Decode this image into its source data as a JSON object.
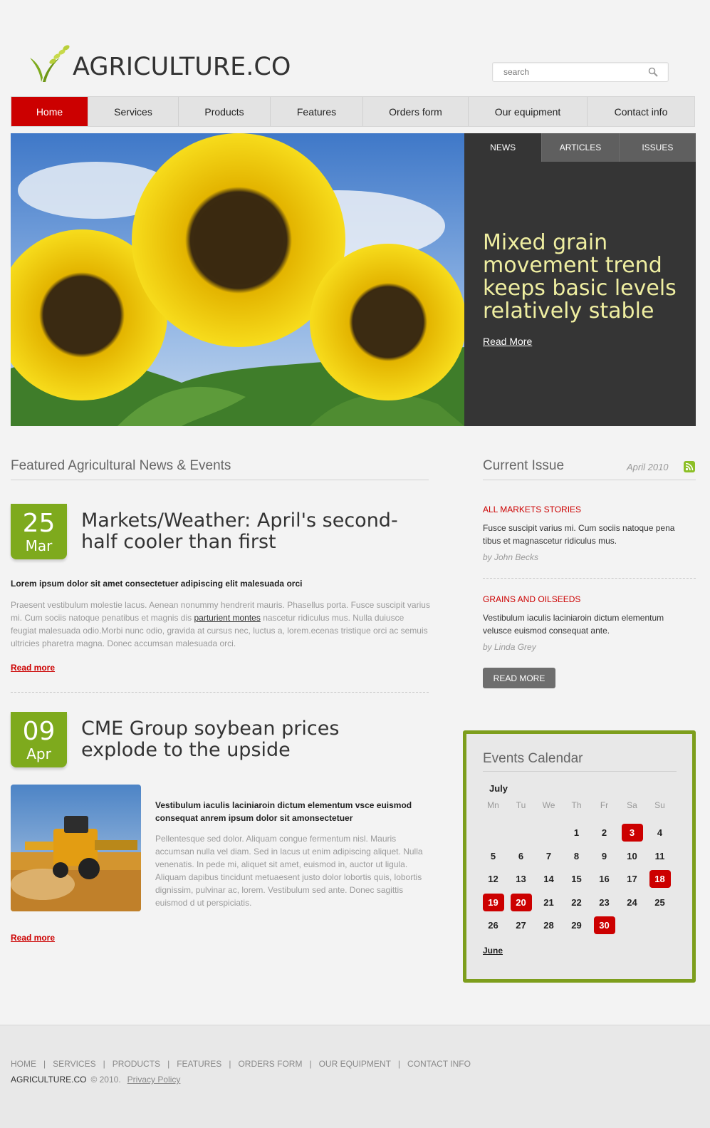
{
  "brand": {
    "name": "AGRICULTURE.CO",
    "accent": "#cc0000",
    "green": "#7eaa1d"
  },
  "search": {
    "placeholder": "search"
  },
  "nav": [
    {
      "label": "Home",
      "active": true
    },
    {
      "label": "Services"
    },
    {
      "label": "Products"
    },
    {
      "label": "Features"
    },
    {
      "label": "Orders form"
    },
    {
      "label": "Our equipment"
    },
    {
      "label": "Contact info"
    }
  ],
  "hero": {
    "tabs": [
      "NEWS",
      "ARTICLES",
      "ISSUES"
    ],
    "headline": "Mixed grain movement trend keeps basic levels relatively stable",
    "read_more": "Read More"
  },
  "featured": {
    "title": "Featured Agricultural News & Events",
    "articles": [
      {
        "day": "25",
        "month": "Mar",
        "title": "Markets/Weather: April's second-half cooler than first",
        "lead": "Lorem ipsum dolor sit amet consectetuer adipiscing elit malesuada orci",
        "body_before": "Praesent vestibulum molestie lacus. Aenean nonummy hendrerit mauris. Phasellus porta. Fusce suscipit varius mi. Cum sociis natoque penatibus et magnis dis ",
        "body_link": "parturient montes",
        "body_after": " nascetur ridiculus mus. Nulla duiusce feugiat malesuada odio.Morbi nunc odio, gravida at cursus nec, luctus a, lorem.ecenas tristique orci ac semuis ultricies pharetra magna. Donec accumsan malesuada orci.",
        "read_more": "Read more"
      },
      {
        "day": "09",
        "month": "Apr",
        "title": "CME Group soybean prices explode to the upside",
        "lead": "Vestibulum iaculis laciniaroin dictum elementum vsce euismod consequat anrem ipsum dolor sit amonsectetuer",
        "body": "Pellentesque sed dolor. Aliquam congue fermentum nisl. Mauris accumsan nulla vel diam. Sed in lacus ut enim adipiscing aliquet. Nulla venenatis. In pede mi, aliquet sit amet, euismod in, auctor ut ligula. Aliquam dapibus tincidunt metuaesent justo dolor lobortis quis, lobortis dignissim, pulvinar ac, lorem. Vestibulum sed ante. Donec sagittis euismod d ut perspiciatis.",
        "read_more": "Read more"
      }
    ]
  },
  "issue": {
    "title": "Current Issue",
    "date": "April 2010",
    "stories": [
      {
        "heading": "ALL MARKETS STORIES",
        "text": "Fusce suscipit varius mi. Cum sociis natoque pena tibus et magnascetur ridiculus mus.",
        "byline": "by John Becks"
      },
      {
        "heading": "GRAINS AND OILSEEDS",
        "text": "Vestibulum iaculis laciniaroin dictum elementum velusce euismod consequat ante.",
        "byline": "by Linda Grey"
      }
    ],
    "button": "READ MORE"
  },
  "calendar": {
    "title": "Events Calendar",
    "month": "July",
    "weekdays": [
      "Mn",
      "Tu",
      "We",
      "Th",
      "Fr",
      "Sa",
      "Su"
    ],
    "leading_blanks": 3,
    "days": 30,
    "highlighted": [
      3,
      18,
      19,
      20,
      30
    ],
    "prev_link": "June"
  },
  "footer": {
    "links": [
      "HOME",
      "SERVICES",
      "PRODUCTS",
      "FEATURES",
      "ORDERS FORM",
      "OUR EQUIPMENT",
      "CONTACT INFO"
    ],
    "separator": "|",
    "brand": "AGRICULTURE.CO",
    "copyright": "©  2010.",
    "privacy": "Privacy Policy"
  }
}
